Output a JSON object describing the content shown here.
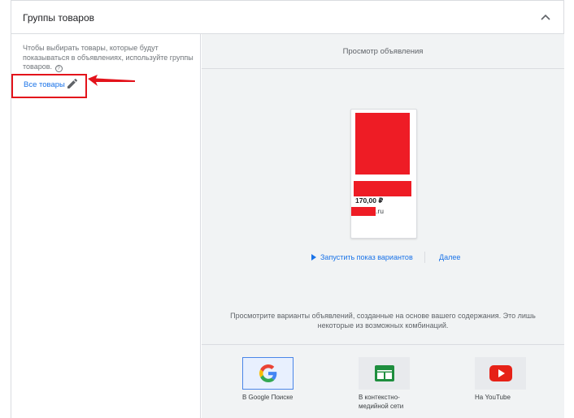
{
  "header": {
    "title": "Группы товаров"
  },
  "left": {
    "hint": "Чтобы выбирать товары, которые будут показываться в объявлениях, используйте группы товаров.",
    "help_glyph": "?",
    "all_products": "Все товары"
  },
  "preview": {
    "title": "Просмотр объявления",
    "ad": {
      "price": "170,00 ₽",
      "domain_suffix": ".ru"
    },
    "run_label": "Запустить показ вариантов",
    "next_label": "Далее",
    "description": "Просмотрите варианты объявлений, созданные на основе вашего содержания. Это лишь некоторые из возможных комбинаций."
  },
  "tabs": [
    {
      "label": "В Google Поиске",
      "icon": "google-icon",
      "active": true
    },
    {
      "label": "В контекстно-медийной сети",
      "icon": "display-network-icon",
      "active": false
    },
    {
      "label": "На YouTube",
      "icon": "youtube-icon",
      "active": false
    }
  ],
  "colors": {
    "accent": "#1a73e8",
    "redaction": "#ee1c25",
    "annotation": "#e3131b"
  }
}
